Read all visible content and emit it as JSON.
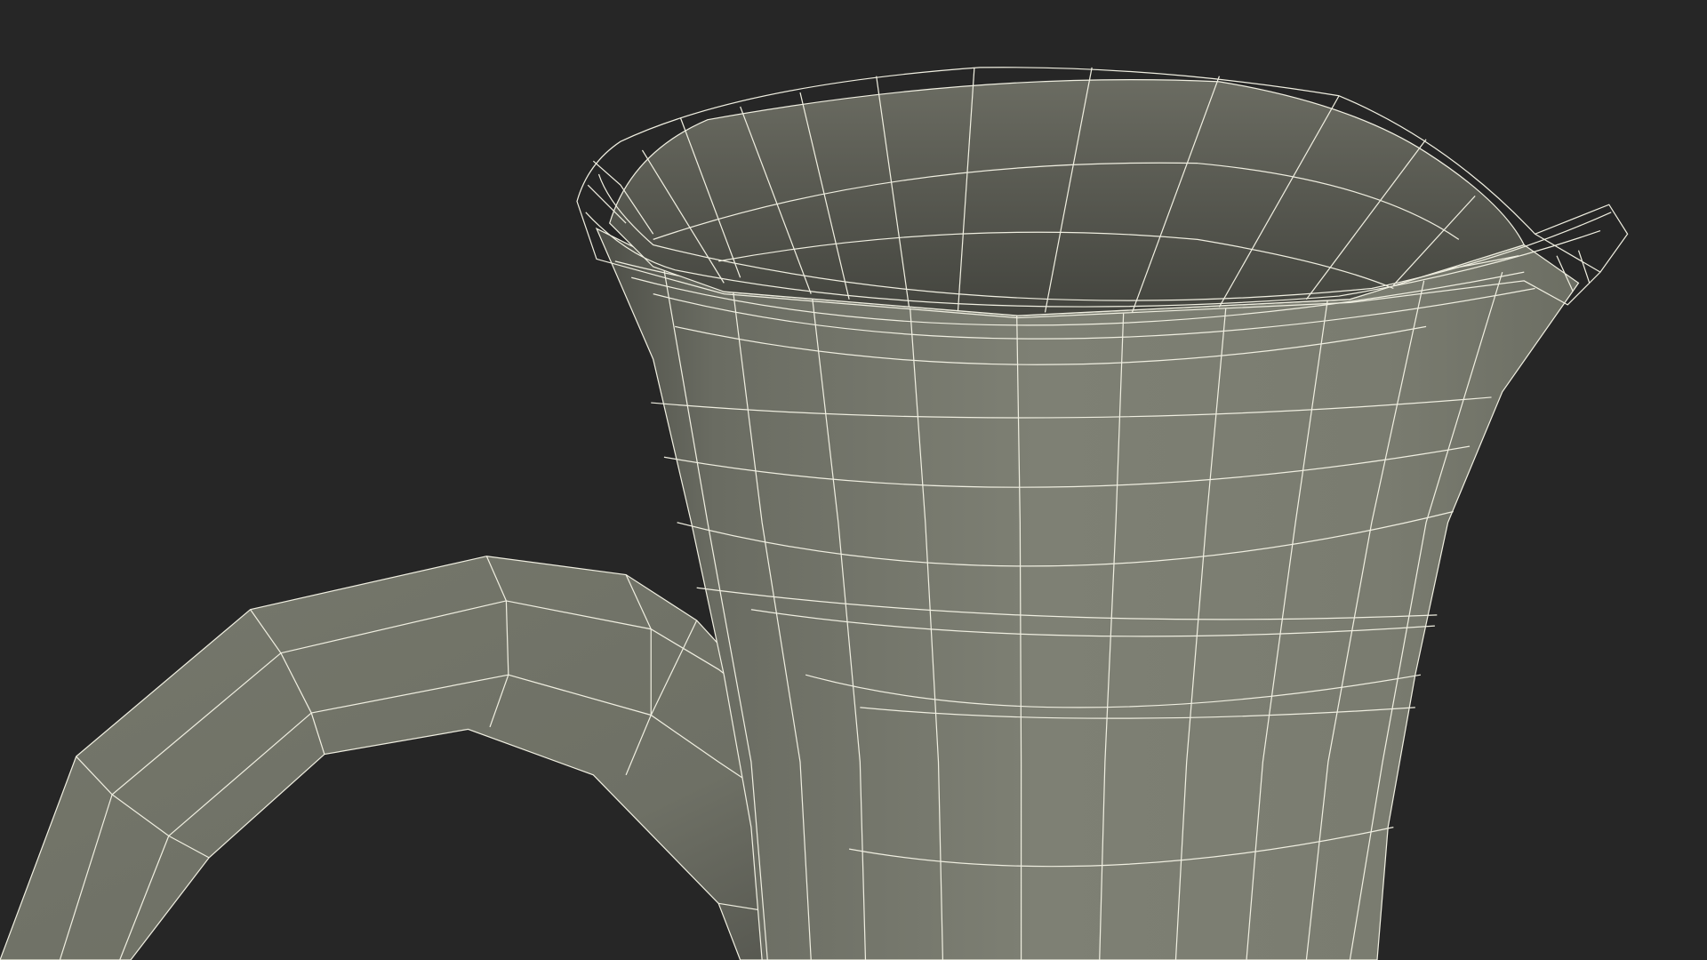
{
  "scene": {
    "subject": "pitcher-wireframe-render",
    "colors": {
      "background": "#262626",
      "surface_light": "#7c7e72",
      "surface_mid": "#6f7166",
      "surface_dark": "#4a4b44",
      "interior_dark": "#46463f",
      "wire": "#efeee0"
    }
  }
}
